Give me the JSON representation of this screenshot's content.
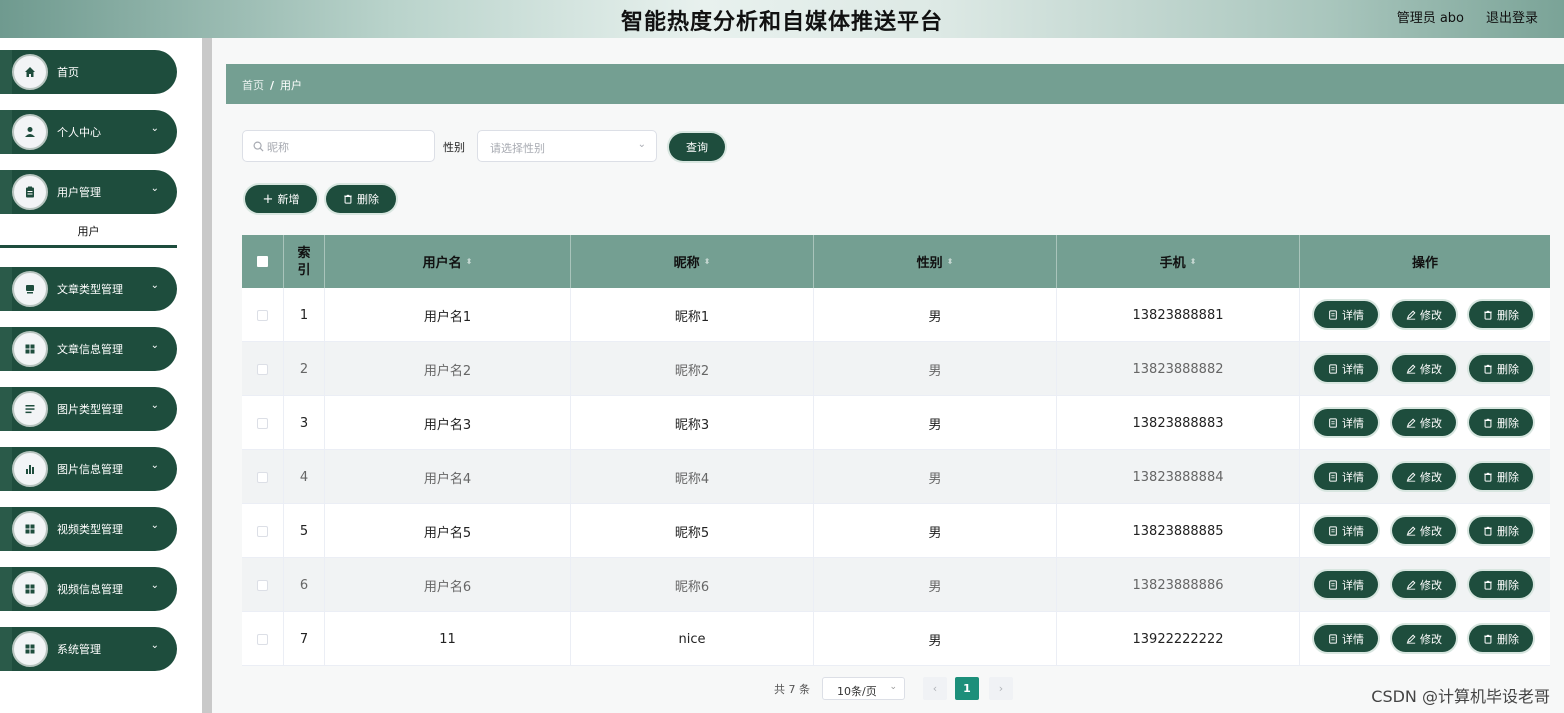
{
  "header": {
    "title": "智能热度分析和自媒体推送平台",
    "user": "管理员 abo",
    "logout": "退出登录"
  },
  "sidebar": {
    "items": [
      {
        "label": "首页",
        "icon": "home-icon",
        "chevron": ""
      },
      {
        "label": "个人中心",
        "icon": "person-icon",
        "chevron": "⌄"
      },
      {
        "label": "用户管理",
        "icon": "clipboard-icon",
        "chevron": "⌄"
      },
      {
        "label": "文章类型管理",
        "icon": "card-icon",
        "chevron": "⌄"
      },
      {
        "label": "文章信息管理",
        "icon": "grid-icon",
        "chevron": "⌄"
      },
      {
        "label": "图片类型管理",
        "icon": "list-icon",
        "chevron": "⌄"
      },
      {
        "label": "图片信息管理",
        "icon": "bar-chart-icon",
        "chevron": "⌄"
      },
      {
        "label": "视频类型管理",
        "icon": "grid-icon",
        "chevron": "⌄"
      },
      {
        "label": "视频信息管理",
        "icon": "grid-icon",
        "chevron": "⌄"
      },
      {
        "label": "系统管理",
        "icon": "grid-icon",
        "chevron": "⌄"
      }
    ],
    "sub_item": "用户"
  },
  "breadcrumb": {
    "home": "首页",
    "separator": "/",
    "current": "用户"
  },
  "search": {
    "nickname_placeholder": "昵称",
    "gender_label": "性别",
    "gender_placeholder": "请选择性别",
    "query_button": "查询"
  },
  "toolbar": {
    "add_label": "新增",
    "delete_label": "删除"
  },
  "table": {
    "headers": {
      "index": "索引",
      "username": "用户名",
      "nickname": "昵称",
      "gender": "性别",
      "phone": "手机",
      "actions": "操作"
    },
    "sort_glyph": "⬍",
    "action_labels": {
      "detail": "详情",
      "edit": "修改",
      "delete": "删除"
    },
    "rows": [
      {
        "index": "1",
        "username": "用户名1",
        "nickname": "昵称1",
        "gender": "男",
        "phone": "13823888881"
      },
      {
        "index": "2",
        "username": "用户名2",
        "nickname": "昵称2",
        "gender": "男",
        "phone": "13823888882"
      },
      {
        "index": "3",
        "username": "用户名3",
        "nickname": "昵称3",
        "gender": "男",
        "phone": "13823888883"
      },
      {
        "index": "4",
        "username": "用户名4",
        "nickname": "昵称4",
        "gender": "男",
        "phone": "13823888884"
      },
      {
        "index": "5",
        "username": "用户名5",
        "nickname": "昵称5",
        "gender": "男",
        "phone": "13823888885"
      },
      {
        "index": "6",
        "username": "用户名6",
        "nickname": "昵称6",
        "gender": "男",
        "phone": "13823888886"
      },
      {
        "index": "7",
        "username": "11",
        "nickname": "nice",
        "gender": "男",
        "phone": "13922222222"
      }
    ]
  },
  "pagination": {
    "total": "共 7 条",
    "page_size": "10条/页",
    "prev": "‹",
    "current_page": "1",
    "next": "›"
  },
  "watermark": "CSDN @计算机毕设老哥",
  "colors": {
    "primary": "#1e4d3d",
    "header_teal": "#749f92",
    "active_page": "#1c8f7a"
  }
}
